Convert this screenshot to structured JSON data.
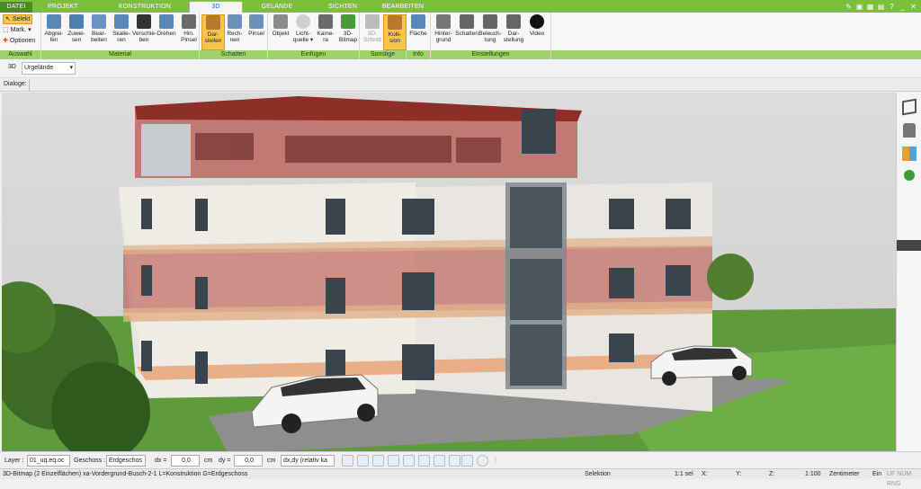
{
  "tabs": [
    {
      "label": "DATEI"
    },
    {
      "label": "PROJEKT"
    },
    {
      "label": "KONSTRUKTION"
    },
    {
      "label": "3D"
    },
    {
      "label": "GELÄNDE"
    },
    {
      "label": "SICHTEN"
    },
    {
      "label": "BEARBEITEN"
    }
  ],
  "ribbon": {
    "auswahl": {
      "label": "Auswahl",
      "selekt": "Selekt",
      "mark": "Mark.",
      "optionen": "Optionen"
    },
    "material": {
      "label": "Material",
      "buttons": [
        {
          "label": "Abgrei-\nfen"
        },
        {
          "label": "Zuwei-\nsen"
        },
        {
          "label": "Bear-\nbeiten"
        },
        {
          "label": "Skalie-\nren"
        },
        {
          "label": "Verschie-\nben"
        },
        {
          "label": "Drehen"
        },
        {
          "label": "Hin.\nPinsel"
        }
      ]
    },
    "schatten": {
      "label": "Schatten",
      "buttons": [
        {
          "label": "Dar-\nstellen"
        },
        {
          "label": "Rech-\nnen"
        },
        {
          "label": "Pinsel"
        }
      ]
    },
    "einfuegen": {
      "label": "Einfügen",
      "buttons": [
        {
          "label": "Objekt"
        },
        {
          "label": "Licht-\nquelle ▾"
        },
        {
          "label": "Kame-\nra"
        },
        {
          "label": "3D-\nBitmap"
        }
      ]
    },
    "sonstige": {
      "label": "Sonstige",
      "buttons": [
        {
          "label": "3D-\nSchnitt"
        },
        {
          "label": "Kolli-\nsion"
        }
      ]
    },
    "info": {
      "label": "Info",
      "buttons": [
        {
          "label": "Fläche"
        }
      ]
    },
    "einstellungen": {
      "label": "Einstellungen",
      "buttons": [
        {
          "label": "Hinter-\ngrund"
        },
        {
          "label": "Schatten"
        },
        {
          "label": "Beleuch-\ntung"
        },
        {
          "label": "Dar-\nstellung"
        },
        {
          "label": "Video"
        }
      ]
    }
  },
  "toolbar2": {
    "mode": "3D",
    "terrain_select": "Urgelände"
  },
  "dialoge": {
    "label": "Dialoge:"
  },
  "status": {
    "layer_label": "Layer :",
    "layer_value": "01_uq.eq.oc",
    "geschoss_label": "Geschoss :",
    "geschoss_value": "Erdgeschos",
    "dx_label": "dx =",
    "dx_value": "0,0",
    "dx_unit": "cm",
    "dy_label": "dy =",
    "dy_value": "0,0",
    "dy_unit": "cm",
    "mode_value": "dx,dy (relativ ka"
  },
  "info": {
    "text": "3D-Bitmap (2 Einzelflächen) xa-Vordergrund-Busch-2-1 L=Konstruktion G=Erdgeschoss",
    "selektion": "Selektion",
    "count": "1:1 sel",
    "x": "X:",
    "y": "Y:",
    "z": "Z:",
    "scale": "1:100",
    "unit": "Zentimeter",
    "ein": "Ein",
    "caps": "UF NUM RNG"
  },
  "colors": {
    "accent": "#7cbf3a",
    "highlight": "#f6c54e",
    "group_label": "#9fd36a"
  }
}
